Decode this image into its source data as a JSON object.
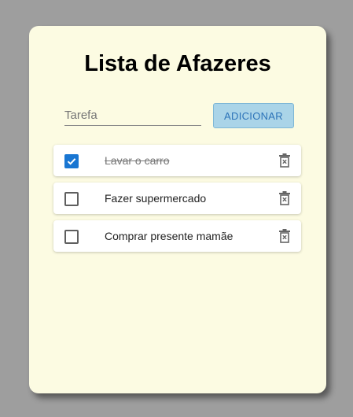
{
  "app": {
    "title": "Lista de Afazeres"
  },
  "form": {
    "input_placeholder": "Tarefa",
    "input_value": "",
    "add_label": "ADICIONAR"
  },
  "items": [
    {
      "label": "Lavar o carro",
      "done": true
    },
    {
      "label": "Fazer supermercado",
      "done": false
    },
    {
      "label": "Comprar presente mamãe",
      "done": false
    }
  ],
  "icons": {
    "checkbox": "check-icon",
    "delete": "trash-icon"
  },
  "colors": {
    "page_background": "#9e9e9e",
    "card_background": "#fcfbe2",
    "accent": "#1976d2",
    "button_background": "#aad4e8",
    "button_text": "#2c73b8"
  }
}
